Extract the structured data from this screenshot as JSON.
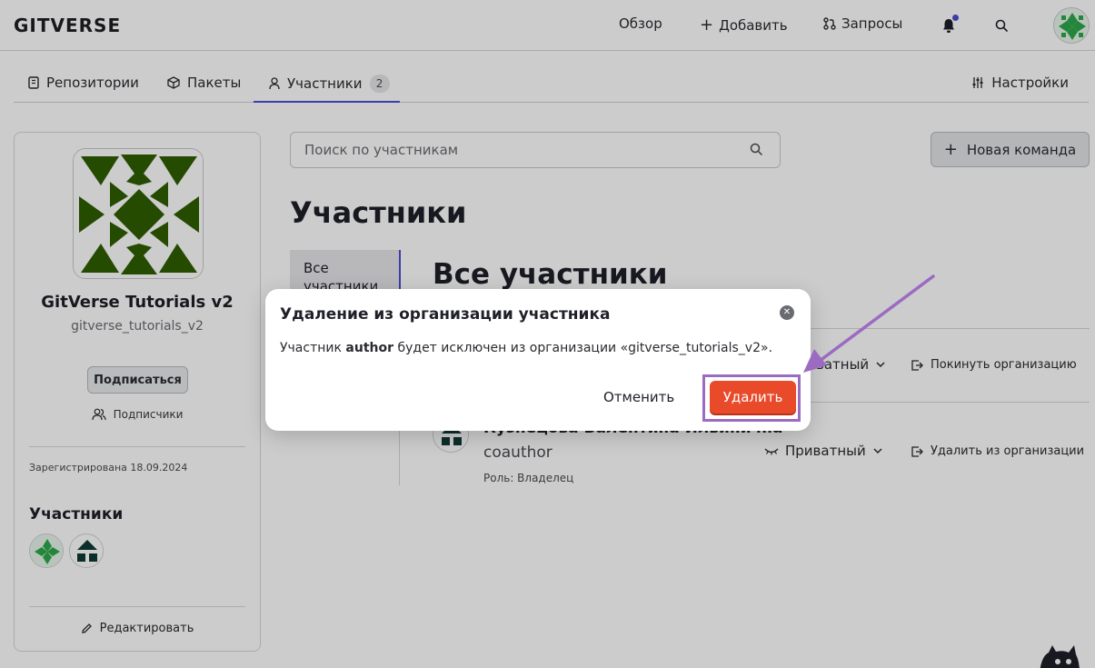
{
  "header": {
    "logo": "GITVERSE",
    "nav": {
      "overview": "Обзор",
      "add": "Добавить",
      "requests": "Запросы"
    },
    "icons": [
      "bell-icon",
      "search-icon",
      "user-avatar"
    ]
  },
  "tabs": {
    "repos": "Репозитории",
    "packages": "Пакеты",
    "members": "Участники",
    "members_count": "2",
    "settings": "Настройки"
  },
  "sidebar": {
    "org_name": "GitVerse Tutorials v2",
    "org_login": "gitverse_tutorials_v2",
    "subscribe": "Подписаться",
    "followers": "Подписчики",
    "registered": "Зарегистрирована 18.09.2024",
    "members_title": "Участники",
    "edit": "Редактировать"
  },
  "main": {
    "search_placeholder": "Поиск по участникам",
    "new_team": "Новая команда",
    "title": "Участники",
    "menu_all": "Все участники",
    "section_title": "Все участники",
    "rows": [
      {
        "name": "",
        "login": "",
        "role": "",
        "visibility": "ватный",
        "action": "Покинуть организацию"
      },
      {
        "name": "Кузнецова Валентина Ильинична",
        "login": "coauthor",
        "role": "Роль: Владелец",
        "visibility": "Приватный",
        "action": "Удалить из организации"
      }
    ]
  },
  "modal": {
    "title": "Удаление из организации участника",
    "text_prefix": "Участник ",
    "text_user": "author",
    "text_suffix": " будет исключен из организации «gitverse_tutorials_v2».",
    "cancel": "Отменить",
    "delete": "Удалить"
  },
  "colors": {
    "accent": "#4c4cd6",
    "danger": "#e84a2a",
    "annotation": "#9b6bc2",
    "org_avatar": "#2e5e00"
  }
}
